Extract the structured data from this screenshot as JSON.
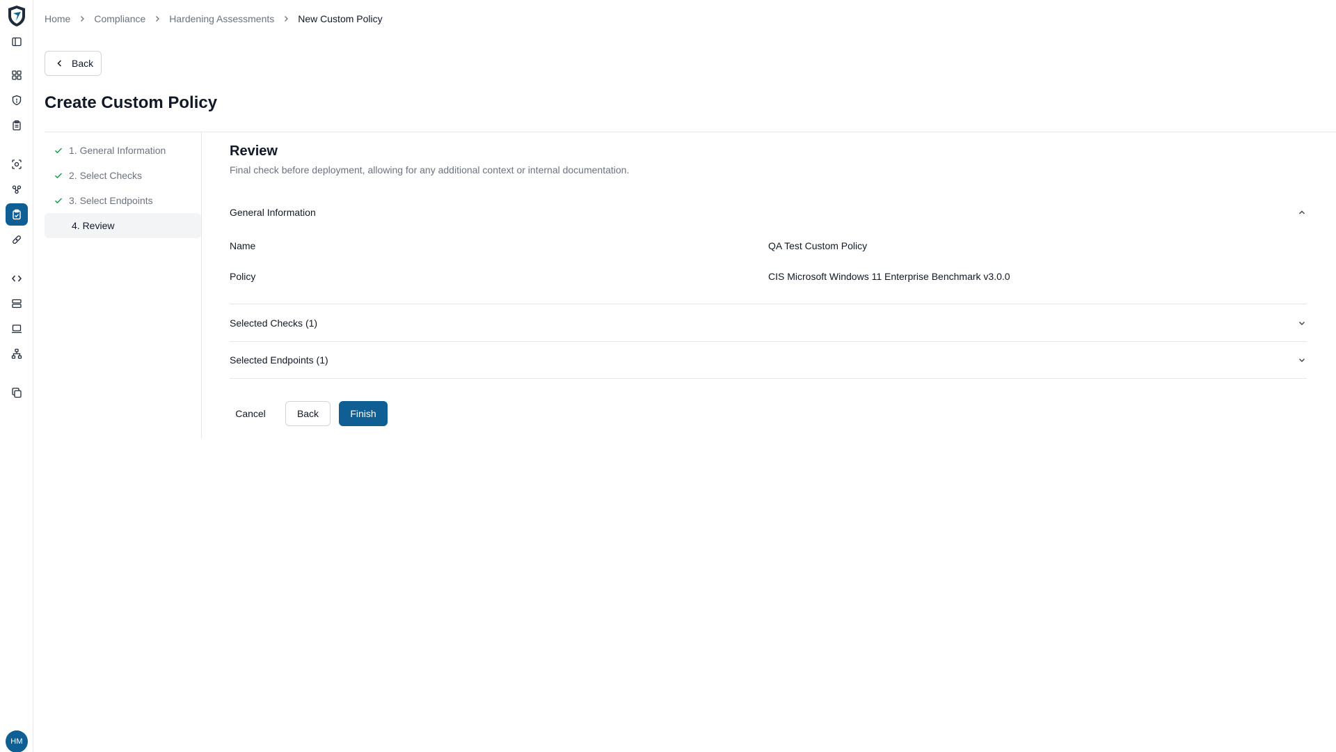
{
  "breadcrumb": {
    "items": [
      "Home",
      "Compliance",
      "Hardening Assessments"
    ],
    "current": "New Custom Policy"
  },
  "header": {
    "back_label": "Back",
    "title": "Create Custom Policy"
  },
  "steps": [
    {
      "label": "1. General Information",
      "done": true
    },
    {
      "label": "2. Select Checks",
      "done": true
    },
    {
      "label": "3. Select Endpoints",
      "done": true
    },
    {
      "label": "4. Review",
      "done": false,
      "active": true
    }
  ],
  "review": {
    "title": "Review",
    "subtitle": "Final check before deployment, allowing for any additional context or internal documentation.",
    "general": {
      "heading": "General Information",
      "name_label": "Name",
      "name_value": "QA Test Custom Policy",
      "policy_label": "Policy",
      "policy_value": "CIS Microsoft Windows 11 Enterprise Benchmark v3.0.0"
    },
    "checks_heading": "Selected Checks (1)",
    "endpoints_heading": "Selected Endpoints (1)"
  },
  "actions": {
    "cancel": "Cancel",
    "back": "Back",
    "finish": "Finish"
  },
  "user": {
    "initials": "HM"
  },
  "colors": {
    "accent": "#0f5f94",
    "check": "#16a34a"
  }
}
